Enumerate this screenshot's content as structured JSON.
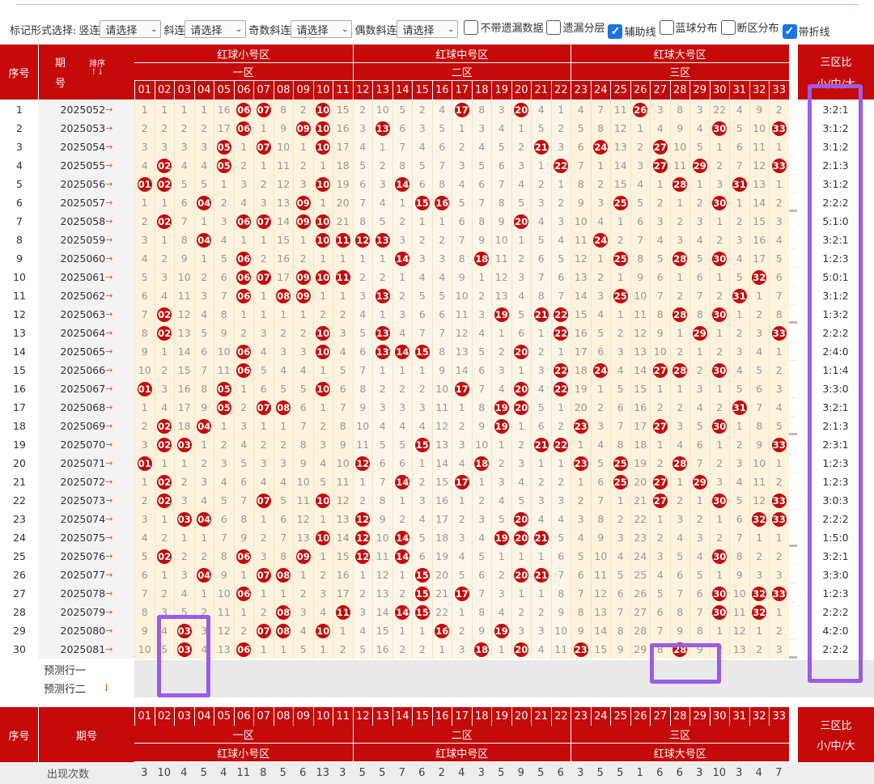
{
  "toolbar": {
    "mark_form_label": "标记形式选择:",
    "selects": [
      {
        "label": "竖连",
        "value": "请选择"
      },
      {
        "label": "斜连",
        "value": "请选择"
      },
      {
        "label": "奇数斜连",
        "value": "请选择"
      },
      {
        "label": "偶数斜连",
        "value": "请选择"
      }
    ],
    "checkboxes": [
      {
        "label": "不带遗漏数据",
        "checked": false
      },
      {
        "label": "遗漏分层",
        "checked": false
      },
      {
        "label": "辅助线",
        "checked": true
      },
      {
        "label": "蓝球分布",
        "checked": false
      },
      {
        "label": "断区分布",
        "checked": false
      },
      {
        "label": "带折线",
        "checked": true
      }
    ]
  },
  "header": {
    "seq": "序号",
    "period_top": "期",
    "period_bottom": "号",
    "sort_label": "排序",
    "sort_icon": "sort-arrows-icon",
    "zones": [
      {
        "group": "红球小号区",
        "name": "一区"
      },
      {
        "group": "红球中号区",
        "name": "二区"
      },
      {
        "group": "红球大号区",
        "name": "三区"
      }
    ],
    "ratio_title": "三区比",
    "ratio_sub": "小/中/大",
    "numbers": [
      "01",
      "02",
      "03",
      "04",
      "05",
      "06",
      "07",
      "08",
      "09",
      "10",
      "11",
      "12",
      "13",
      "14",
      "15",
      "16",
      "17",
      "18",
      "19",
      "20",
      "21",
      "22",
      "23",
      "24",
      "25",
      "26",
      "27",
      "28",
      "29",
      "30",
      "31",
      "32",
      "33"
    ]
  },
  "footer": {
    "seq": "序号",
    "period": "期号",
    "count_label": "出现次数",
    "counts": [
      "3",
      "10",
      "4",
      "5",
      "4",
      "11",
      "8",
      "5",
      "6",
      "13",
      "3",
      "5",
      "5",
      "7",
      "6",
      "2",
      "4",
      "3",
      "5",
      "9",
      "5",
      "6",
      "3",
      "5",
      "5",
      "1",
      "6",
      "6",
      "3",
      "10",
      "3",
      "4",
      "7"
    ]
  },
  "predict": [
    {
      "label": "预测行一"
    },
    {
      "label": "预测行二",
      "icon": "down-arrow-icon"
    }
  ],
  "colors": {
    "primary_red": "#c40a0a",
    "cell_bg": "#fdf2dc",
    "highlight": "#9b5de5",
    "arrow_orange": "#e06010"
  },
  "rows": [
    {
      "seq": "1",
      "period": "2025052",
      "ratio": "3:2:1",
      "cells": [
        "1",
        "1",
        "1",
        "1",
        "16",
        "b06",
        "b07",
        "8",
        "2",
        "b10",
        "15",
        "2",
        "10",
        "5",
        "2",
        "4",
        "b17",
        "8",
        "3",
        "b20",
        "4",
        "1",
        "4",
        "7",
        "11",
        "b26",
        "3",
        "8",
        "3",
        "22",
        "4",
        "9",
        "2"
      ]
    },
    {
      "seq": "2",
      "period": "2025053",
      "ratio": "3:1:2",
      "cells": [
        "2",
        "2",
        "2",
        "2",
        "17",
        "b06",
        "1",
        "9",
        "b09",
        "b10",
        "16",
        "3",
        "b13",
        "6",
        "3",
        "5",
        "1",
        "3",
        "4",
        "1",
        "5",
        "2",
        "5",
        "8",
        "12",
        "1",
        "4",
        "9",
        "4",
        "b30",
        "5",
        "10",
        "b33"
      ]
    },
    {
      "seq": "3",
      "period": "2025054",
      "ratio": "3:1:2",
      "cells": [
        "3",
        "3",
        "3",
        "3",
        "b05",
        "1",
        "b07",
        "10",
        "1",
        "b10",
        "17",
        "4",
        "1",
        "7",
        "4",
        "6",
        "2",
        "4",
        "5",
        "2",
        "b21",
        "3",
        "6",
        "b24",
        "13",
        "2",
        "b27",
        "10",
        "5",
        "1",
        "6",
        "11",
        "1"
      ]
    },
    {
      "seq": "4",
      "period": "2025055",
      "ratio": "2:1:3",
      "cells": [
        "4",
        "b02",
        "4",
        "4",
        "b05",
        "2",
        "1",
        "11",
        "2",
        "1",
        "18",
        "5",
        "2",
        "8",
        "5",
        "7",
        "3",
        "5",
        "6",
        "3",
        "1",
        "b22",
        "7",
        "1",
        "14",
        "3",
        "b27",
        "11",
        "b29",
        "2",
        "7",
        "12",
        "b33"
      ]
    },
    {
      "seq": "5",
      "period": "2025056",
      "ratio": "3:1:2",
      "cells": [
        "b01",
        "b02",
        "5",
        "5",
        "1",
        "3",
        "2",
        "12",
        "3",
        "b10",
        "19",
        "6",
        "3",
        "b14",
        "6",
        "8",
        "4",
        "6",
        "7",
        "4",
        "2",
        "1",
        "8",
        "2",
        "15",
        "4",
        "1",
        "b28",
        "1",
        "3",
        "b31",
        "13",
        "1"
      ]
    },
    {
      "seq": "6",
      "period": "2025057",
      "ratio": "2:2:2",
      "cells": [
        "1",
        "1",
        "6",
        "b04",
        "2",
        "4",
        "3",
        "13",
        "b09",
        "1",
        "20",
        "7",
        "4",
        "1",
        "b15",
        "b16",
        "5",
        "7",
        "8",
        "5",
        "3",
        "2",
        "9",
        "3",
        "b25",
        "5",
        "2",
        "1",
        "2",
        "b30",
        "1",
        "14",
        "2"
      ]
    },
    {
      "seq": "7",
      "period": "2025058",
      "ratio": "5:1:0",
      "cells": [
        "2",
        "b02",
        "7",
        "1",
        "3",
        "b06",
        "b07",
        "14",
        "b09",
        "b10",
        "21",
        "8",
        "5",
        "2",
        "1",
        "1",
        "6",
        "8",
        "9",
        "b20",
        "4",
        "3",
        "10",
        "4",
        "1",
        "6",
        "3",
        "2",
        "3",
        "1",
        "2",
        "15",
        "3"
      ]
    },
    {
      "seq": "8",
      "period": "2025059",
      "ratio": "3:2:1",
      "cells": [
        "3",
        "1",
        "8",
        "b04",
        "4",
        "1",
        "1",
        "15",
        "1",
        "b10",
        "b11",
        "b12",
        "b13",
        "3",
        "2",
        "2",
        "7",
        "9",
        "10",
        "1",
        "5",
        "4",
        "11",
        "b24",
        "2",
        "7",
        "4",
        "3",
        "4",
        "2",
        "3",
        "16",
        "4"
      ]
    },
    {
      "seq": "9",
      "period": "2025060",
      "ratio": "1:2:3",
      "cells": [
        "4",
        "2",
        "9",
        "1",
        "5",
        "b06",
        "2",
        "16",
        "2",
        "1",
        "1",
        "1",
        "1",
        "b14",
        "3",
        "3",
        "8",
        "b18",
        "11",
        "2",
        "6",
        "5",
        "12",
        "1",
        "b25",
        "8",
        "5",
        "b28",
        "5",
        "b30",
        "4",
        "17",
        "5"
      ]
    },
    {
      "seq": "10",
      "period": "2025061",
      "ratio": "5:0:1",
      "cells": [
        "5",
        "3",
        "10",
        "2",
        "6",
        "b06",
        "b07",
        "17",
        "b09",
        "b10",
        "b11",
        "2",
        "2",
        "1",
        "4",
        "4",
        "9",
        "1",
        "12",
        "3",
        "7",
        "6",
        "13",
        "2",
        "1",
        "9",
        "6",
        "1",
        "6",
        "1",
        "5",
        "b32",
        "6"
      ]
    },
    {
      "seq": "11",
      "period": "2025062",
      "ratio": "3:1:2",
      "cells": [
        "6",
        "4",
        "11",
        "3",
        "7",
        "b06",
        "1",
        "b08",
        "b09",
        "1",
        "1",
        "3",
        "b13",
        "2",
        "5",
        "5",
        "10",
        "2",
        "13",
        "4",
        "8",
        "7",
        "14",
        "3",
        "b25",
        "10",
        "7",
        "2",
        "7",
        "2",
        "b31",
        "1",
        "7"
      ]
    },
    {
      "seq": "12",
      "period": "2025063",
      "ratio": "1:3:2",
      "cells": [
        "7",
        "b02",
        "12",
        "4",
        "8",
        "1",
        "1",
        "1",
        "1",
        "2",
        "2",
        "4",
        "1",
        "3",
        "6",
        "6",
        "11",
        "3",
        "b19",
        "5",
        "b21",
        "b22",
        "15",
        "4",
        "1",
        "11",
        "8",
        "b28",
        "8",
        "b30",
        "1",
        "2",
        "8"
      ]
    },
    {
      "seq": "13",
      "period": "2025064",
      "ratio": "2:2:2",
      "cells": [
        "8",
        "b02",
        "13",
        "5",
        "9",
        "2",
        "3",
        "2",
        "2",
        "b10",
        "3",
        "5",
        "b13",
        "4",
        "7",
        "7",
        "12",
        "4",
        "1",
        "6",
        "1",
        "b22",
        "16",
        "5",
        "2",
        "12",
        "9",
        "1",
        "b29",
        "1",
        "2",
        "3",
        "b33"
      ]
    },
    {
      "seq": "14",
      "period": "2025065",
      "ratio": "2:4:0",
      "cells": [
        "9",
        "1",
        "14",
        "6",
        "10",
        "b06",
        "4",
        "3",
        "3",
        "b10",
        "4",
        "6",
        "b13",
        "b14",
        "b15",
        "8",
        "13",
        "5",
        "2",
        "b20",
        "2",
        "1",
        "17",
        "6",
        "3",
        "13",
        "10",
        "2",
        "1",
        "2",
        "3",
        "4",
        "1"
      ]
    },
    {
      "seq": "15",
      "period": "2025066",
      "ratio": "1:1:4",
      "cells": [
        "10",
        "2",
        "15",
        "7",
        "11",
        "b06",
        "5",
        "4",
        "4",
        "1",
        "5",
        "7",
        "1",
        "1",
        "1",
        "9",
        "14",
        "6",
        "3",
        "1",
        "3",
        "b22",
        "18",
        "b24",
        "4",
        "14",
        "b27",
        "b28",
        "2",
        "b30",
        "4",
        "5",
        "2"
      ]
    },
    {
      "seq": "16",
      "period": "2025067",
      "ratio": "3:3:0",
      "cells": [
        "b01",
        "3",
        "16",
        "8",
        "b05",
        "1",
        "6",
        "5",
        "5",
        "b10",
        "6",
        "8",
        "2",
        "2",
        "2",
        "10",
        "b17",
        "7",
        "4",
        "b20",
        "4",
        "b22",
        "19",
        "1",
        "5",
        "15",
        "1",
        "1",
        "3",
        "1",
        "5",
        "6",
        "3"
      ]
    },
    {
      "seq": "17",
      "period": "2025068",
      "ratio": "3:2:1",
      "cells": [
        "1",
        "4",
        "17",
        "9",
        "b05",
        "2",
        "b07",
        "b08",
        "6",
        "1",
        "7",
        "9",
        "3",
        "3",
        "3",
        "11",
        "1",
        "8",
        "b19",
        "b20",
        "5",
        "1",
        "20",
        "2",
        "6",
        "16",
        "2",
        "2",
        "4",
        "2",
        "b31",
        "7",
        "4"
      ]
    },
    {
      "seq": "18",
      "period": "2025069",
      "ratio": "2:1:3",
      "cells": [
        "2",
        "b02",
        "18",
        "b04",
        "1",
        "3",
        "1",
        "1",
        "7",
        "2",
        "8",
        "10",
        "4",
        "4",
        "4",
        "12",
        "2",
        "9",
        "b19",
        "1",
        "6",
        "2",
        "b23",
        "3",
        "7",
        "17",
        "b27",
        "3",
        "5",
        "b30",
        "1",
        "8",
        "5"
      ]
    },
    {
      "seq": "19",
      "period": "2025070",
      "ratio": "2:3:1",
      "cells": [
        "3",
        "b02",
        "b03",
        "1",
        "2",
        "4",
        "2",
        "2",
        "8",
        "3",
        "9",
        "11",
        "5",
        "5",
        "b15",
        "13",
        "3",
        "10",
        "1",
        "2",
        "b21",
        "b22",
        "1",
        "4",
        "8",
        "18",
        "1",
        "4",
        "6",
        "1",
        "2",
        "9",
        "b33"
      ]
    },
    {
      "seq": "20",
      "period": "2025071",
      "ratio": "1:2:3",
      "cells": [
        "b01",
        "1",
        "1",
        "2",
        "3",
        "5",
        "3",
        "3",
        "9",
        "4",
        "10",
        "b12",
        "6",
        "6",
        "1",
        "14",
        "4",
        "b18",
        "2",
        "3",
        "1",
        "1",
        "b23",
        "5",
        "b25",
        "19",
        "2",
        "b28",
        "7",
        "2",
        "3",
        "10",
        "1"
      ]
    },
    {
      "seq": "21",
      "period": "2025072",
      "ratio": "1:2:3",
      "cells": [
        "1",
        "b02",
        "2",
        "3",
        "4",
        "6",
        "4",
        "4",
        "10",
        "5",
        "11",
        "1",
        "7",
        "b14",
        "2",
        "15",
        "b17",
        "1",
        "3",
        "4",
        "2",
        "2",
        "1",
        "6",
        "b25",
        "20",
        "b27",
        "1",
        "b29",
        "3",
        "4",
        "11",
        "2"
      ]
    },
    {
      "seq": "22",
      "period": "2025073",
      "ratio": "3:0:3",
      "cells": [
        "2",
        "b02",
        "3",
        "4",
        "5",
        "7",
        "b07",
        "5",
        "11",
        "b10",
        "12",
        "2",
        "8",
        "1",
        "3",
        "16",
        "1",
        "2",
        "4",
        "5",
        "3",
        "3",
        "2",
        "7",
        "1",
        "21",
        "b27",
        "2",
        "1",
        "b30",
        "5",
        "12",
        "b33"
      ]
    },
    {
      "seq": "23",
      "period": "2025074",
      "ratio": "2:2:2",
      "cells": [
        "3",
        "1",
        "b03",
        "b04",
        "6",
        "8",
        "1",
        "6",
        "12",
        "1",
        "13",
        "b12",
        "9",
        "2",
        "4",
        "17",
        "2",
        "3",
        "5",
        "b20",
        "4",
        "4",
        "3",
        "8",
        "2",
        "22",
        "1",
        "3",
        "2",
        "1",
        "6",
        "b32",
        "b33"
      ]
    },
    {
      "seq": "24",
      "period": "2025075",
      "ratio": "1:5:0",
      "cells": [
        "4",
        "2",
        "1",
        "1",
        "7",
        "9",
        "2",
        "7",
        "13",
        "b10",
        "14",
        "b12",
        "10",
        "b14",
        "5",
        "18",
        "3",
        "4",
        "b19",
        "b20",
        "b21",
        "5",
        "4",
        "9",
        "3",
        "23",
        "2",
        "4",
        "3",
        "2",
        "7",
        "1",
        "1"
      ]
    },
    {
      "seq": "25",
      "period": "2025076",
      "ratio": "3:2:1",
      "cells": [
        "5",
        "b02",
        "2",
        "2",
        "8",
        "b06",
        "3",
        "8",
        "b09",
        "1",
        "15",
        "b12",
        "11",
        "b14",
        "6",
        "19",
        "4",
        "5",
        "1",
        "1",
        "1",
        "6",
        "5",
        "10",
        "4",
        "24",
        "3",
        "5",
        "4",
        "b30",
        "8",
        "2",
        "2"
      ]
    },
    {
      "seq": "26",
      "period": "2025077",
      "ratio": "3:3:0",
      "cells": [
        "6",
        "1",
        "3",
        "b04",
        "9",
        "1",
        "b07",
        "b08",
        "1",
        "2",
        "16",
        "1",
        "12",
        "1",
        "b15",
        "20",
        "5",
        "6",
        "2",
        "b20",
        "b21",
        "7",
        "6",
        "11",
        "5",
        "25",
        "4",
        "6",
        "5",
        "1",
        "9",
        "3",
        "3"
      ]
    },
    {
      "seq": "27",
      "period": "2025078",
      "ratio": "1:2:3",
      "cells": [
        "7",
        "2",
        "4",
        "1",
        "10",
        "b06",
        "1",
        "1",
        "2",
        "3",
        "17",
        "2",
        "13",
        "2",
        "b15",
        "21",
        "b17",
        "7",
        "3",
        "1",
        "1",
        "8",
        "7",
        "12",
        "6",
        "26",
        "5",
        "7",
        "6",
        "b30",
        "10",
        "b32",
        "b33"
      ]
    },
    {
      "seq": "28",
      "period": "2025079",
      "ratio": "2:2:2",
      "cells": [
        "8",
        "3",
        "5",
        "2",
        "11",
        "1",
        "2",
        "b08",
        "3",
        "4",
        "b11",
        "3",
        "14",
        "b14",
        "b15",
        "22",
        "1",
        "8",
        "4",
        "2",
        "2",
        "9",
        "8",
        "13",
        "7",
        "27",
        "6",
        "8",
        "7",
        "b30",
        "11",
        "b32",
        "1"
      ]
    },
    {
      "seq": "29",
      "period": "2025080",
      "ratio": "4:2:0",
      "cells": [
        "9",
        "4",
        "b03",
        "3",
        "12",
        "2",
        "b07",
        "b08",
        "4",
        "b10",
        "1",
        "4",
        "15",
        "1",
        "1",
        "b16",
        "2",
        "9",
        "b19",
        "3",
        "3",
        "10",
        "9",
        "14",
        "8",
        "28",
        "7",
        "9",
        "8",
        "1",
        "12",
        "1",
        "2"
      ]
    },
    {
      "seq": "30",
      "period": "2025081",
      "ratio": "2:2:2",
      "cells": [
        "10",
        "5",
        "b03",
        "4",
        "13",
        "b06",
        "1",
        "1",
        "5",
        "1",
        "2",
        "5",
        "16",
        "2",
        "2",
        "1",
        "3",
        "b18",
        "1",
        "b20",
        "4",
        "11",
        "b23",
        "15",
        "9",
        "29",
        "8",
        "b28",
        "9",
        "2",
        "13",
        "2",
        "3"
      ]
    }
  ]
}
